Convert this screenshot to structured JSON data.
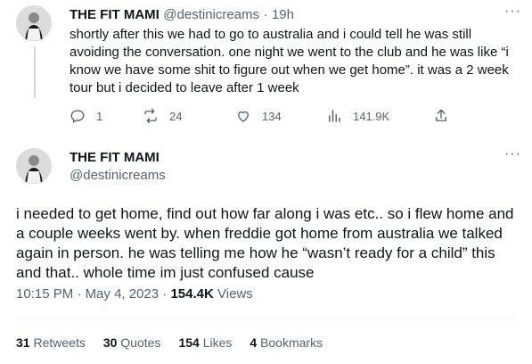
{
  "tweet1": {
    "display_name": "THE FIT MAMI",
    "handle": "@destinicreams",
    "separator": "·",
    "age": "19h",
    "text": "shortly after this we had to go to australia and i could tell he was still avoiding the conversation. one night we went to the club and he was like “i know we have some shit to figure out when we get home”. it was a 2 week tour but i decided to leave after 1 week",
    "replies": "1",
    "retweets": "24",
    "likes": "134",
    "views": "141.9K",
    "more_label": "···"
  },
  "tweet2": {
    "display_name": "THE FIT MAMI",
    "handle": "@destinicreams",
    "text": "i needed to get home, find out how far along i was etc.. so i flew home and a couple weeks went by. when freddie got home from australia we talked again in person. he was telling me how he “wasn’t ready for a child” this and that.. whole time im just confused cause",
    "time": "10:15 PM",
    "dot": "·",
    "date": "May 4, 2023",
    "views_count": "154.4K",
    "views_label": "Views",
    "more_label": "···",
    "stats": {
      "retweets_count": "31",
      "retweets_label": "Retweets",
      "quotes_count": "30",
      "quotes_label": "Quotes",
      "likes_count": "154",
      "likes_label": "Likes",
      "bookmarks_count": "4",
      "bookmarks_label": "Bookmarks"
    }
  },
  "icons": {
    "reply": "reply-icon",
    "retweet": "retweet-icon",
    "like": "heart-icon",
    "views": "views-icon",
    "share": "share-icon",
    "more": "more-icon"
  },
  "colors": {
    "text": "#0f1419",
    "secondary": "#536471",
    "divider": "#eff3f4"
  }
}
